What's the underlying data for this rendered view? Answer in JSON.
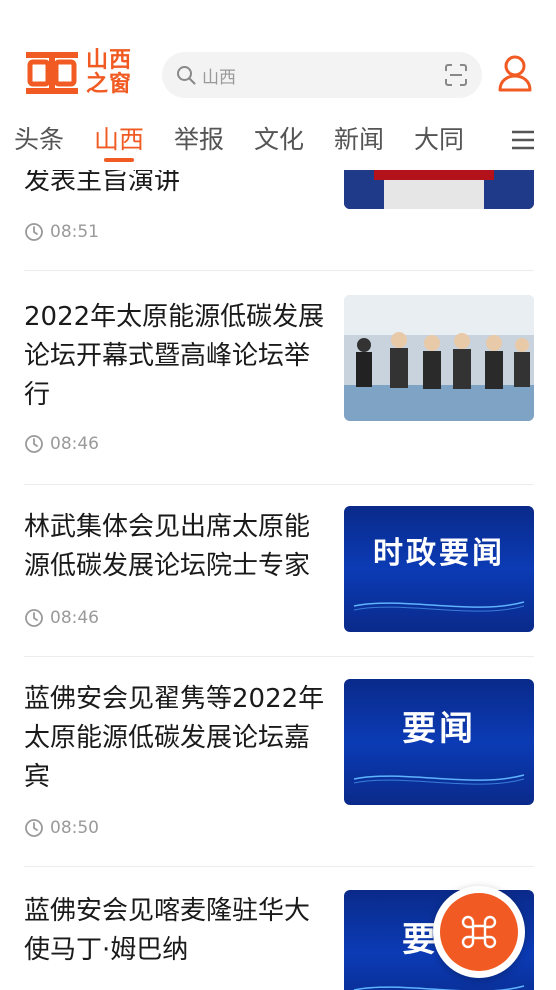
{
  "header": {
    "logo_text_line1": "山西",
    "logo_text_line2": "之窗",
    "search_placeholder": "山西",
    "brand_color": "#f15a22"
  },
  "tabs": [
    {
      "label": "头条",
      "active": false
    },
    {
      "label": "山西",
      "active": true
    },
    {
      "label": "举报",
      "active": false
    },
    {
      "label": "文化",
      "active": false
    },
    {
      "label": "新闻",
      "active": false
    },
    {
      "label": "大同",
      "active": false
    }
  ],
  "feed": [
    {
      "title": "发表主旨演讲",
      "time": "08:51"
    },
    {
      "title": "2022年太原能源低碳发展论坛开幕式暨高峰论坛举行",
      "time": "08:46"
    },
    {
      "title": "林武集体会见出席太原能源低碳发展论坛院士专家",
      "time": "08:46",
      "thumb_label": "时政要闻"
    },
    {
      "title": "蓝佛安会见翟隽等2022年太原能源低碳发展论坛嘉宾",
      "time": "08:50",
      "thumb_label": "要闻"
    },
    {
      "title": "蓝佛安会见喀麦隆驻华大使马丁·姆巴纳",
      "time": "",
      "thumb_label": "要闻"
    }
  ],
  "icons": {
    "search": "search-icon",
    "scan": "scan-icon",
    "user": "user-icon",
    "menu": "menu-icon",
    "clock": "clock-icon",
    "fab": "command-icon"
  }
}
